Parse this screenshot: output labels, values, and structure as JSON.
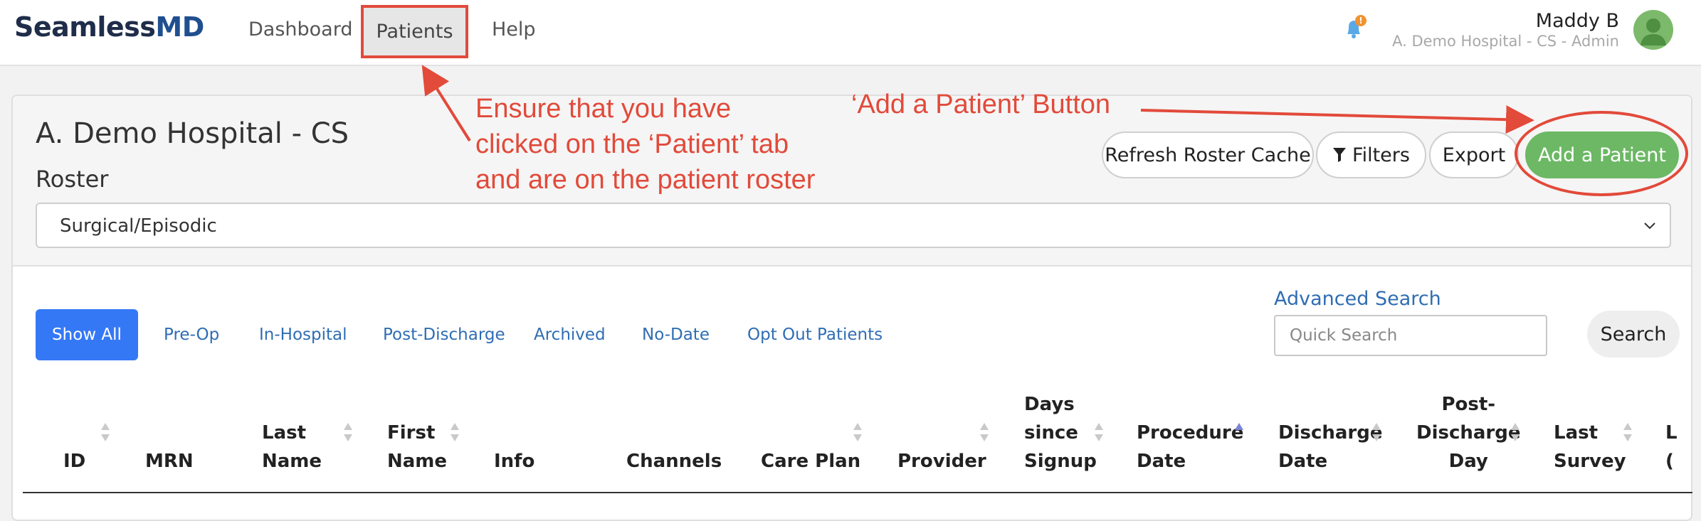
{
  "header": {
    "logo_part1": "Seamless",
    "logo_part2": "MD",
    "nav": [
      {
        "label": "Dashboard"
      },
      {
        "label": "Patients"
      },
      {
        "label": "Help"
      }
    ],
    "notification_icon": "bell-icon",
    "notification_badge": "!",
    "user": {
      "name": "Maddy B",
      "role": "A. Demo Hospital - CS - Admin"
    }
  },
  "panel": {
    "hospital_title": "A. Demo Hospital - CS",
    "roster_label": "Roster",
    "roster_value": "Surgical/Episodic",
    "buttons": {
      "refresh": "Refresh Roster Cache",
      "filters": "Filters",
      "export": "Export",
      "add": "Add a Patient"
    }
  },
  "tabs": [
    {
      "label": "Show All"
    },
    {
      "label": "Pre-Op"
    },
    {
      "label": "In-Hospital"
    },
    {
      "label": "Post-Discharge"
    },
    {
      "label": "Archived"
    },
    {
      "label": "No-Date"
    },
    {
      "label": "Opt Out Patients"
    }
  ],
  "search": {
    "advanced_label": "Advanced Search",
    "placeholder": "Quick Search",
    "button": "Search"
  },
  "table": {
    "columns": [
      {
        "label": "ID"
      },
      {
        "label": "MRN"
      },
      {
        "label": "Last\nName"
      },
      {
        "label": "First\nName"
      },
      {
        "label": "Info"
      },
      {
        "label": "Channels"
      },
      {
        "label": "Care Plan"
      },
      {
        "label": "Provider"
      },
      {
        "label": "Days\nsince\nSignup"
      },
      {
        "label": "Procedure\nDate"
      },
      {
        "label": "Discharge\nDate"
      },
      {
        "label": "Post-\nDischarge\nDay"
      },
      {
        "label": "Last\nSurvey"
      },
      {
        "label": "L\n("
      }
    ]
  },
  "annotations": {
    "patients_tab_note": "Ensure that you have\nclicked on the ‘Patient’ tab\nand are on the patient roster",
    "add_button_note": "‘Add a Patient’ Button"
  },
  "colors": {
    "accent_blue": "#3478f6",
    "add_green": "#6cb865",
    "annotation_red": "#e24a3a",
    "link_blue": "#2f6db3"
  }
}
